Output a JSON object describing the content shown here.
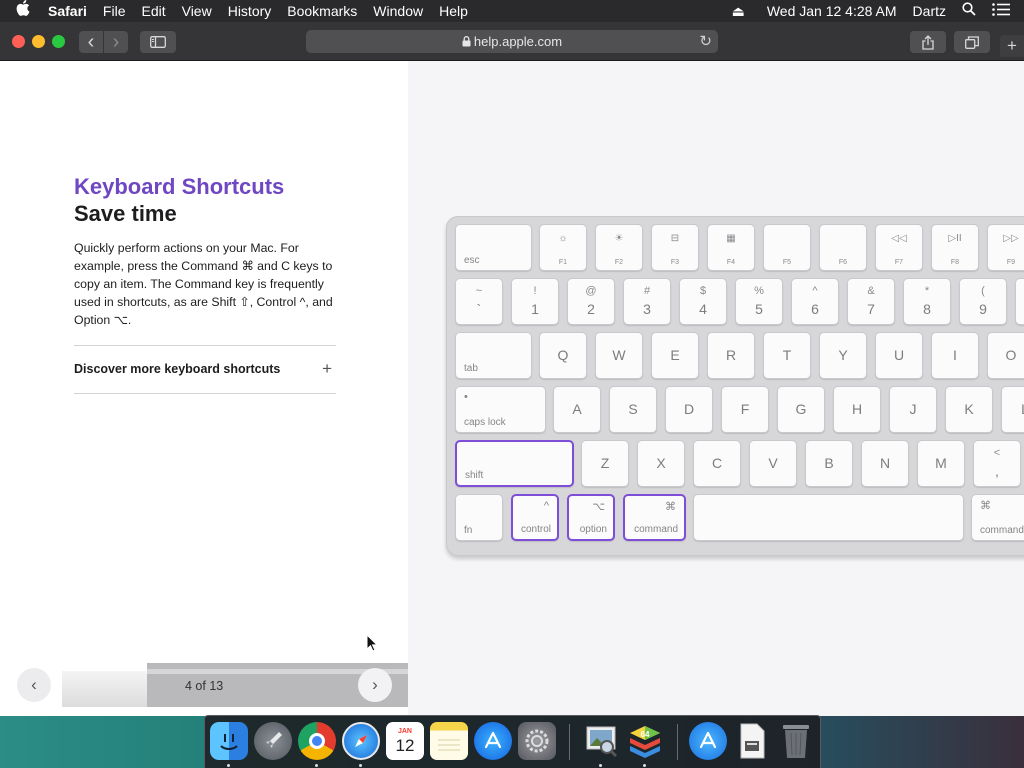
{
  "menubar": {
    "apple_icon": "",
    "app_name": "Safari",
    "items": [
      "File",
      "Edit",
      "View",
      "History",
      "Bookmarks",
      "Window",
      "Help"
    ],
    "right": {
      "eject_icon": "⏏",
      "datetime": "Wed Jan 12  4:28 AM",
      "user": "Dartz",
      "search_icon": "⌕",
      "list_icon": "☰"
    }
  },
  "toolbar": {
    "back_icon": "‹",
    "forward_icon": "›",
    "sidebar_icon": "▥",
    "lock_icon": "🔒",
    "url": "help.apple.com",
    "reload_icon": "↻",
    "share_icon": "⇪",
    "tabs_icon": "⧉",
    "new_tab_icon": "+"
  },
  "article": {
    "eyebrow": "Keyboard Shortcuts",
    "headline": "Save time",
    "body": "Quickly perform actions on your Mac. For example, press the Command ⌘ and C keys to copy an item. The Command key is frequently used in shortcuts, as are Shift ⇧, Control ^, and Option ⌥.",
    "discover_label": "Discover more keyboard shortcuts",
    "discover_icon": "+"
  },
  "pager": {
    "prev_icon": "‹",
    "next_icon": "›",
    "label": "4 of 13",
    "current": 4,
    "total": 13
  },
  "keyboard": {
    "highlight_color": "#7f4ed8",
    "esc": "esc",
    "fkeys": [
      {
        "icon": "☼",
        "label": "F1"
      },
      {
        "icon": "☀",
        "label": "F2"
      },
      {
        "icon": "⊟",
        "label": "F3"
      },
      {
        "icon": "▦",
        "label": "F4"
      },
      {
        "icon": "",
        "label": "F5"
      },
      {
        "icon": "",
        "label": "F6"
      },
      {
        "icon": "◁◁",
        "label": "F7"
      },
      {
        "icon": "▷II",
        "label": "F8"
      },
      {
        "icon": "▷▷",
        "label": "F9"
      }
    ],
    "numbers": [
      {
        "top": "~",
        "bottom": "`"
      },
      {
        "top": "!",
        "bottom": "1"
      },
      {
        "top": "@",
        "bottom": "2"
      },
      {
        "top": "#",
        "bottom": "3"
      },
      {
        "top": "$",
        "bottom": "4"
      },
      {
        "top": "%",
        "bottom": "5"
      },
      {
        "top": "^",
        "bottom": "6"
      },
      {
        "top": "&",
        "bottom": "7"
      },
      {
        "top": "*",
        "bottom": "8"
      },
      {
        "top": "(",
        "bottom": "9"
      }
    ],
    "tab": "tab",
    "qrow": [
      "Q",
      "W",
      "E",
      "R",
      "T",
      "Y",
      "U",
      "I",
      "O"
    ],
    "caps_lock": "caps lock",
    "caps_dot": "•",
    "arow": [
      "A",
      "S",
      "D",
      "F",
      "G",
      "H",
      "J",
      "K",
      "L"
    ],
    "shift": "shift",
    "zrow": [
      "Z",
      "X",
      "C",
      "V",
      "B",
      "N",
      "M"
    ],
    "comma": {
      "top": "<",
      "bottom": ","
    },
    "fn": "fn",
    "control": {
      "label": "control",
      "symbol": "^"
    },
    "option": {
      "label": "option",
      "symbol": "⌥"
    },
    "command": {
      "label": "command",
      "symbol": "⌘"
    },
    "command_right": {
      "label": "command",
      "symbol": "⌘"
    }
  },
  "dock": {
    "apps": [
      {
        "name": "Finder",
        "glyph": "☺",
        "color": "#2f8fe8",
        "running": true
      },
      {
        "name": "Launchpad",
        "glyph": "🚀",
        "color": "#6b7077",
        "running": false
      },
      {
        "name": "Chrome",
        "glyph": "◉",
        "color": "#ffffff",
        "running": true
      },
      {
        "name": "Safari",
        "glyph": "✦",
        "color": "#1e88e5",
        "running": true
      },
      {
        "name": "Calendar",
        "glyph": "12",
        "month": "JAN",
        "color": "#ffffff",
        "running": false
      },
      {
        "name": "Notes",
        "glyph": "",
        "color": "#f6d54a",
        "running": false
      },
      {
        "name": "App Store",
        "glyph": "A",
        "color": "#1e90ff",
        "running": false
      },
      {
        "name": "System Preferences",
        "glyph": "⚙",
        "color": "#7a7a80",
        "running": false
      },
      {
        "name": "Preview",
        "glyph": "▣",
        "color": "#c9c9cc",
        "running": true
      },
      {
        "name": "BlueStacks",
        "glyph": "64",
        "color": "#5bbf3c",
        "running": true
      },
      {
        "name": "App Store Downloads",
        "glyph": "A",
        "color": "#2a8fe8",
        "running": false
      },
      {
        "name": "Document",
        "glyph": "▤",
        "color": "#e6e6e8",
        "running": false
      },
      {
        "name": "Trash",
        "glyph": "🗑",
        "color": "#6c6f75",
        "running": false
      }
    ]
  }
}
